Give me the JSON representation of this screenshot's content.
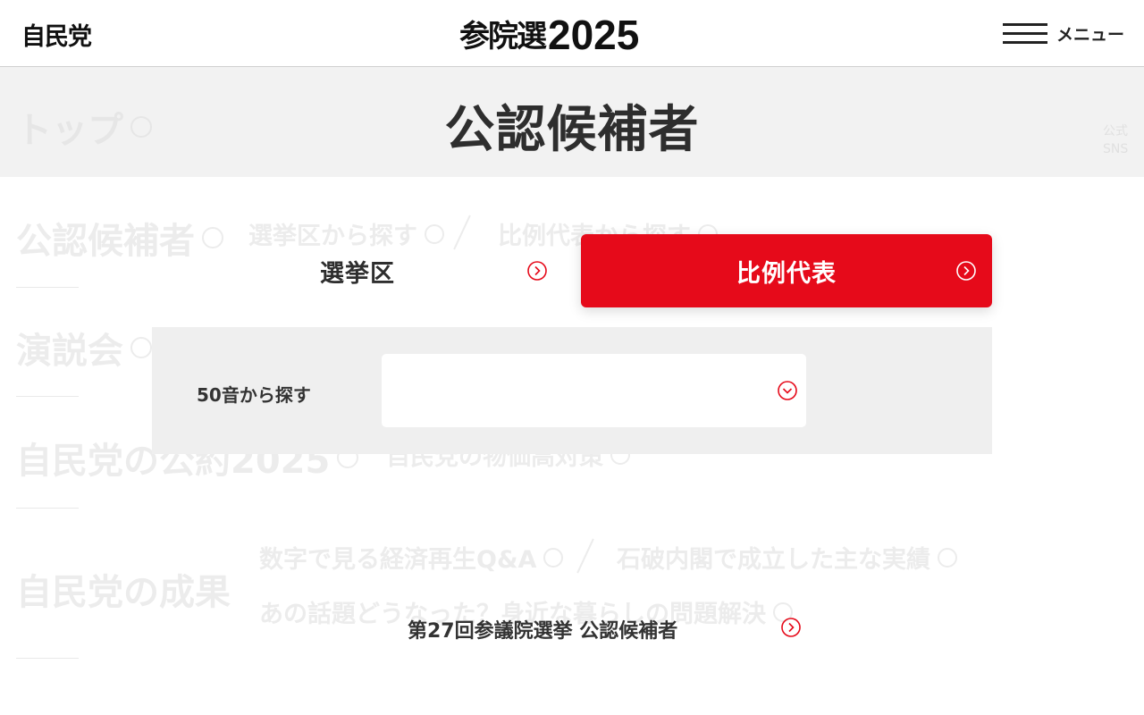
{
  "header": {
    "logo": "自民党",
    "brand_jp": "参院選",
    "brand_year": "2025",
    "menu_label": "メニュー"
  },
  "background_nav": {
    "top": "トップ",
    "candidates": "公認候補者",
    "search_district": "選挙区から探す",
    "search_pr": "比例代表から探す",
    "speeches": "演説会",
    "pledge": "自民党の公約2025",
    "price_measures": "自民党の物価高対策",
    "achievements": "自民党の成果",
    "qa": "数字で見る経済再生Q&A",
    "ishiba": "石破内閣で成立した主な実績",
    "topics": "あの話題どうなった？身近な暮らしの問題解決",
    "sns_line1": "公式",
    "sns_line2": "SNS"
  },
  "page_title": "公認候補者",
  "tabs": [
    {
      "label": "選挙区",
      "active": false
    },
    {
      "label": "比例代表",
      "active": true
    }
  ],
  "search": {
    "label": "50音から探す",
    "selected_value": ""
  },
  "bottom_link": "第27回参議院選挙  公認候補者",
  "colors": {
    "accent_red": "#e60a1a",
    "panel_gray": "#efefef",
    "title_text": "#2e2e2e"
  },
  "icons": {
    "tab_arrow": "circle-chevron-right-icon",
    "select_arrow": "circle-chevron-down-icon"
  }
}
